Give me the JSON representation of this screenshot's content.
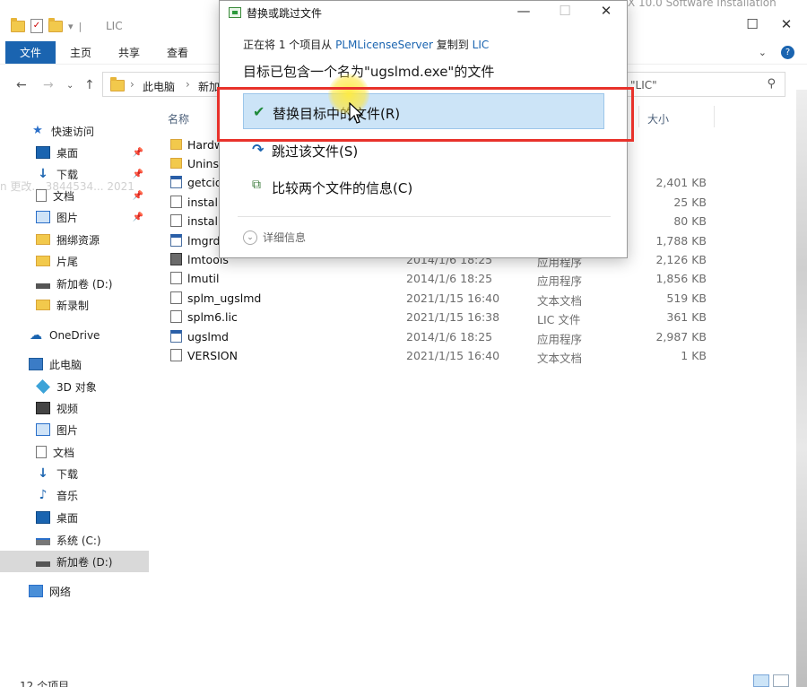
{
  "explorer": {
    "window_title": "LIC",
    "background_title": "X 10.0 Software Installation",
    "controls": {
      "minimize": "—",
      "maximize": "☐",
      "close": "✕"
    },
    "ribbon_tabs": [
      "文件",
      "主页",
      "共享",
      "查看"
    ],
    "address": {
      "part1": "此电脑",
      "part2": "新加",
      "tail": "\"LIC\""
    },
    "columns": {
      "name": "名称",
      "size": "大小"
    },
    "sidebar": [
      {
        "label": "快速访问",
        "icon": "star-icon"
      },
      {
        "label": "桌面",
        "icon": "desktop-icon",
        "pinned": true
      },
      {
        "label": "下载",
        "icon": "download-icon",
        "pinned": true
      },
      {
        "label": "文档",
        "icon": "document-icon",
        "pinned": true
      },
      {
        "label": "图片",
        "icon": "pictures-icon",
        "pinned": true
      },
      {
        "label": "捆绑资源",
        "icon": "folder-icon"
      },
      {
        "label": "片尾",
        "icon": "folder-icon"
      },
      {
        "label": "新加卷 (D:)",
        "icon": "drive-icon"
      },
      {
        "label": "新录制",
        "icon": "folder-icon"
      },
      {
        "label": "OneDrive",
        "icon": "cloud-icon"
      },
      {
        "label": "此电脑",
        "icon": "computer-icon"
      },
      {
        "label": "3D 对象",
        "icon": "3d-objects-icon"
      },
      {
        "label": "视频",
        "icon": "video-icon"
      },
      {
        "label": "图片",
        "icon": "pictures-icon"
      },
      {
        "label": "文档",
        "icon": "document-icon"
      },
      {
        "label": "下载",
        "icon": "download-icon"
      },
      {
        "label": "音乐",
        "icon": "music-icon"
      },
      {
        "label": "桌面",
        "icon": "desktop-icon"
      },
      {
        "label": "系统 (C:)",
        "icon": "system-drive-icon"
      },
      {
        "label": "新加卷 (D:)",
        "icon": "drive-icon",
        "selected": true
      },
      {
        "label": "网络",
        "icon": "network-icon"
      }
    ],
    "files": [
      {
        "name": "Hardw",
        "date": "",
        "type": "",
        "size": "",
        "kind": "folder"
      },
      {
        "name": "Uninst",
        "date": "",
        "type": "",
        "size": "",
        "kind": "folder"
      },
      {
        "name": "getcid",
        "date": "",
        "type": "",
        "size": "2,401 KB",
        "kind": "app"
      },
      {
        "name": "install",
        "date": "",
        "type": "",
        "size": "25 KB",
        "kind": "doc"
      },
      {
        "name": "install",
        "date": "",
        "type": "",
        "size": "80 KB",
        "kind": "doc"
      },
      {
        "name": "lmgrd",
        "date": "",
        "type": "",
        "size": "1,788 KB",
        "kind": "app"
      },
      {
        "name": "lmtools",
        "date": "2014/1/6 18:25",
        "type": "应用程序",
        "size": "2,126 KB",
        "kind": "tool"
      },
      {
        "name": "lmutil",
        "date": "2014/1/6 18:25",
        "type": "应用程序",
        "size": "1,856 KB",
        "kind": "doc"
      },
      {
        "name": "splm_ugslmd",
        "date": "2021/1/15 16:40",
        "type": "文本文档",
        "size": "519 KB",
        "kind": "doc"
      },
      {
        "name": "splm6.lic",
        "date": "2021/1/15 16:38",
        "type": "LIC 文件",
        "size": "361 KB",
        "kind": "doc"
      },
      {
        "name": "ugslmd",
        "date": "2014/1/6 18:25",
        "type": "应用程序",
        "size": "2,987 KB",
        "kind": "app"
      },
      {
        "name": "VERSION",
        "date": "2021/1/15 16:40",
        "type": "文本文档",
        "size": "1 KB",
        "kind": "doc"
      }
    ],
    "status": "12 个项目",
    "watermark": "n 更改... 3844534... 2021"
  },
  "dialog": {
    "title": "替换或跳过文件",
    "from_prefix": "正在将 1 个项目从",
    "from_source": "PLMLicenseServer",
    "from_mid": "复制到",
    "from_dest": "LIC",
    "heading": "目标已包含一个名为\"ugslmd.exe\"的文件",
    "options": {
      "replace": "替换目标中的文件(R)",
      "skip": "跳过该文件(S)",
      "compare": "比较两个文件的信息(C)"
    },
    "details": "详细信息"
  },
  "colors": {
    "accent": "#1a64b0",
    "highlight": "#cce4f7",
    "annotation_box": "#e8322b",
    "check_green": "#1f8a3a"
  }
}
